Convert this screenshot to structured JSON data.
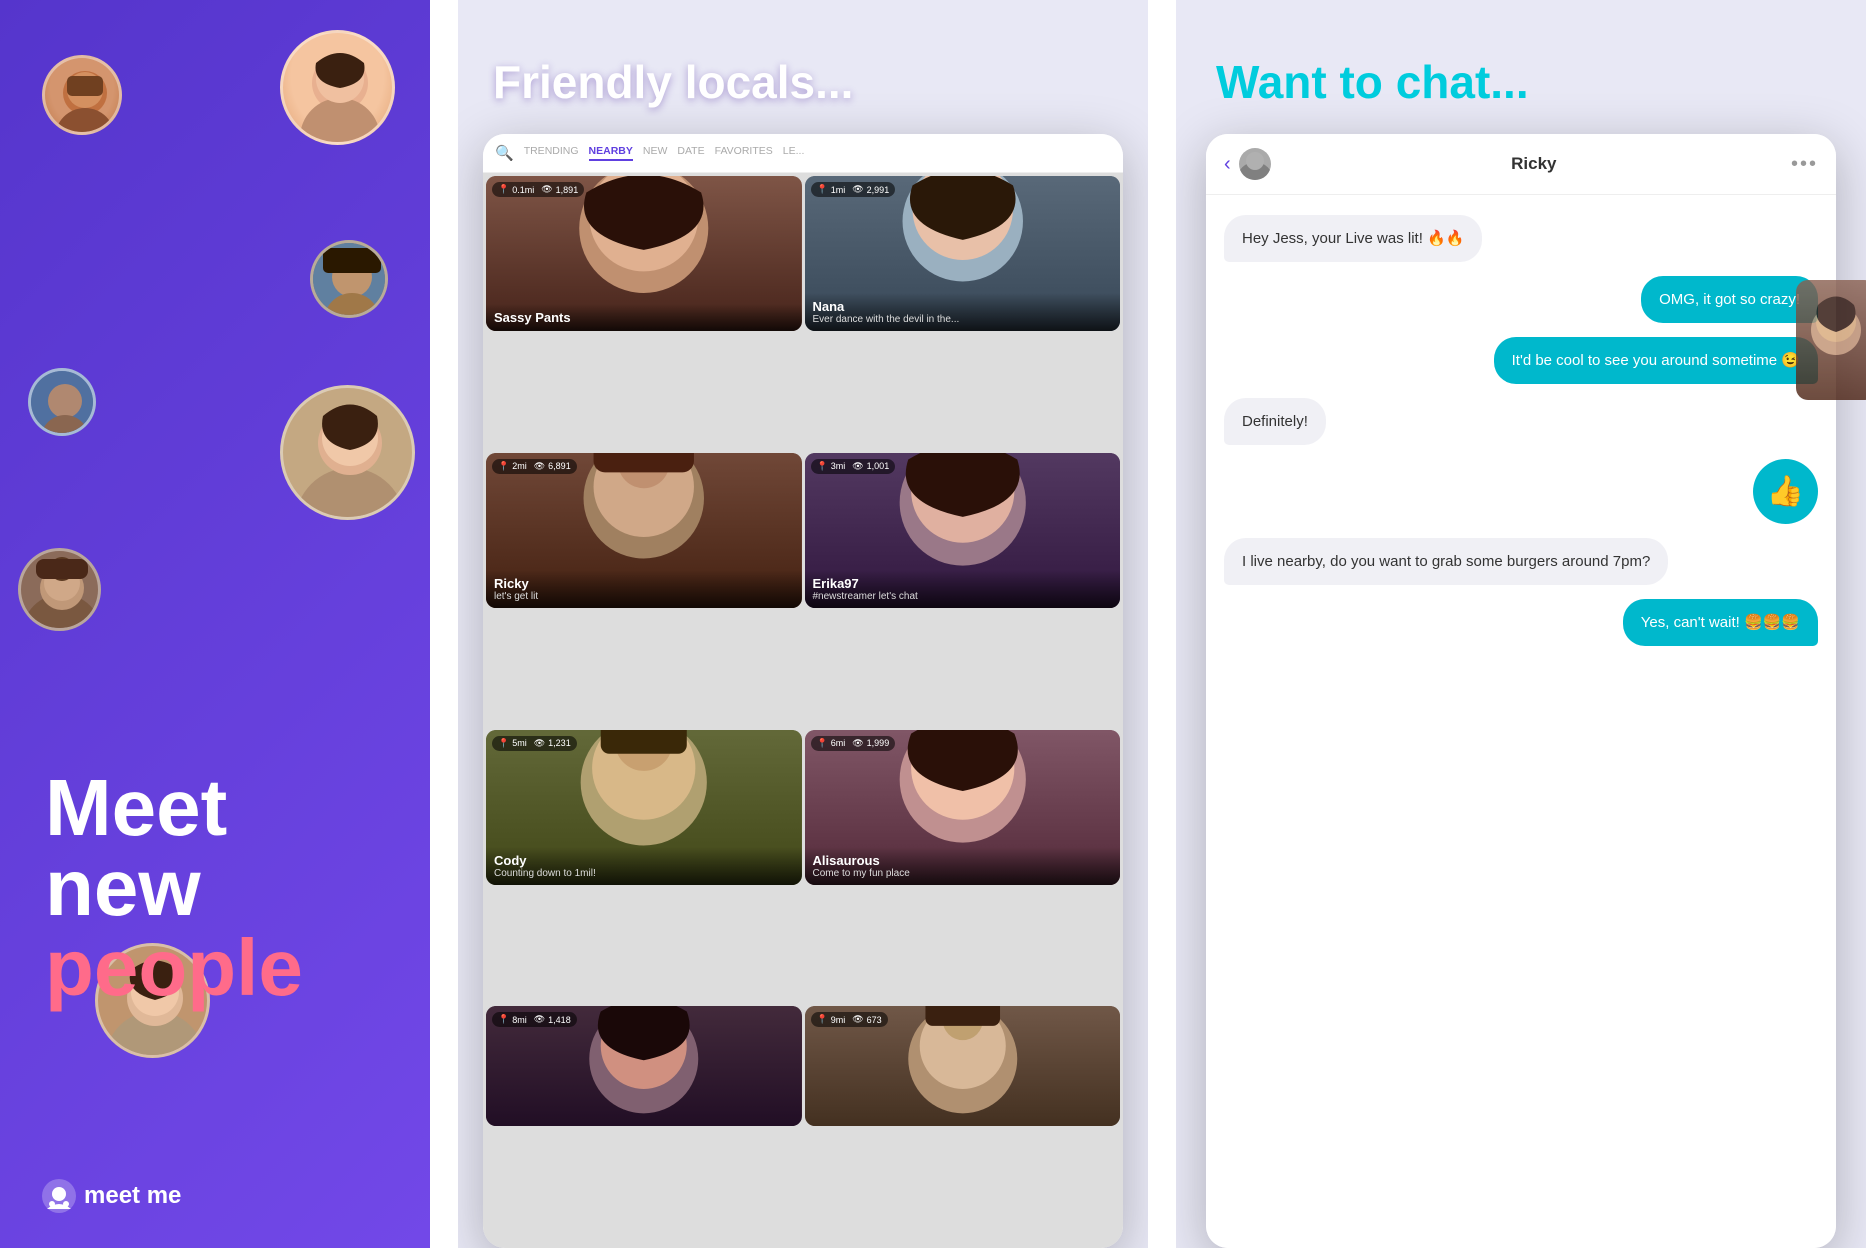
{
  "panel1": {
    "background_color": "#6040e0",
    "title_line1": "Meet",
    "title_line2": "new",
    "title_line3": "people",
    "logo_text": "meet me",
    "avatars": [
      {
        "id": "av-topleft",
        "color": "#a07050"
      },
      {
        "id": "av-topright",
        "color": "#d4956e"
      },
      {
        "id": "av-midright",
        "color": "#8b7355"
      },
      {
        "id": "av-midleft",
        "color": "#6b8cba"
      },
      {
        "id": "av-largeright",
        "color": "#c4a882"
      },
      {
        "id": "av-bottomleft",
        "color": "#8b6b5a"
      },
      {
        "id": "av-bottom",
        "color": "#c0956e"
      }
    ]
  },
  "panel2": {
    "title": "Friendly locals...",
    "nav_tabs": [
      "TRENDING",
      "NEARBY",
      "NEW",
      "DATE",
      "FAVORITES",
      "LE..."
    ],
    "active_tab": "NEARBY",
    "grid_cards": [
      {
        "name": "Sassy Pants",
        "subtitle": "",
        "distance": "0.1mi",
        "views": "1,891",
        "bg": "sassy"
      },
      {
        "name": "Nana",
        "subtitle": "Ever dance with the devil in the...",
        "distance": "1mi",
        "views": "2,991",
        "bg": "nana"
      },
      {
        "name": "Ricky",
        "subtitle": "let's get lit",
        "distance": "2mi",
        "views": "6,891",
        "bg": "ricky"
      },
      {
        "name": "Erika97",
        "subtitle": "#newstreamer let's chat",
        "distance": "3mi",
        "views": "1,001",
        "bg": "erika"
      },
      {
        "name": "Cody",
        "subtitle": "Counting down to 1mil!",
        "distance": "5mi",
        "views": "1,231",
        "bg": "cody"
      },
      {
        "name": "Alisaurous",
        "subtitle": "Come to my fun place",
        "distance": "6mi",
        "views": "1,999",
        "bg": "ali"
      },
      {
        "name": "",
        "subtitle": "",
        "distance": "8mi",
        "views": "1,418",
        "bg": "bottom1"
      },
      {
        "name": "",
        "subtitle": "",
        "distance": "9mi",
        "views": "673",
        "bg": "bottom2"
      }
    ]
  },
  "panel3": {
    "title": "Want to chat...",
    "chat_user": "Ricky",
    "messages": [
      {
        "id": "msg1",
        "type": "received",
        "text": "Hey Jess, your Live was lit! 🔥🔥"
      },
      {
        "id": "msg2",
        "type": "sent",
        "text": "OMG, it got so crazy!"
      },
      {
        "id": "msg3",
        "type": "sent",
        "text": "It'd be cool to see you around sometime 😉"
      },
      {
        "id": "msg4",
        "type": "received",
        "text": "Definitely!"
      },
      {
        "id": "msg5",
        "type": "thumbsup",
        "text": "👍"
      },
      {
        "id": "msg6",
        "type": "received",
        "text": "I live nearby, do you want to grab some burgers around 7pm?"
      },
      {
        "id": "msg7",
        "type": "sent",
        "text": "Yes, can't wait! 🍔🍔🍔"
      }
    ]
  }
}
